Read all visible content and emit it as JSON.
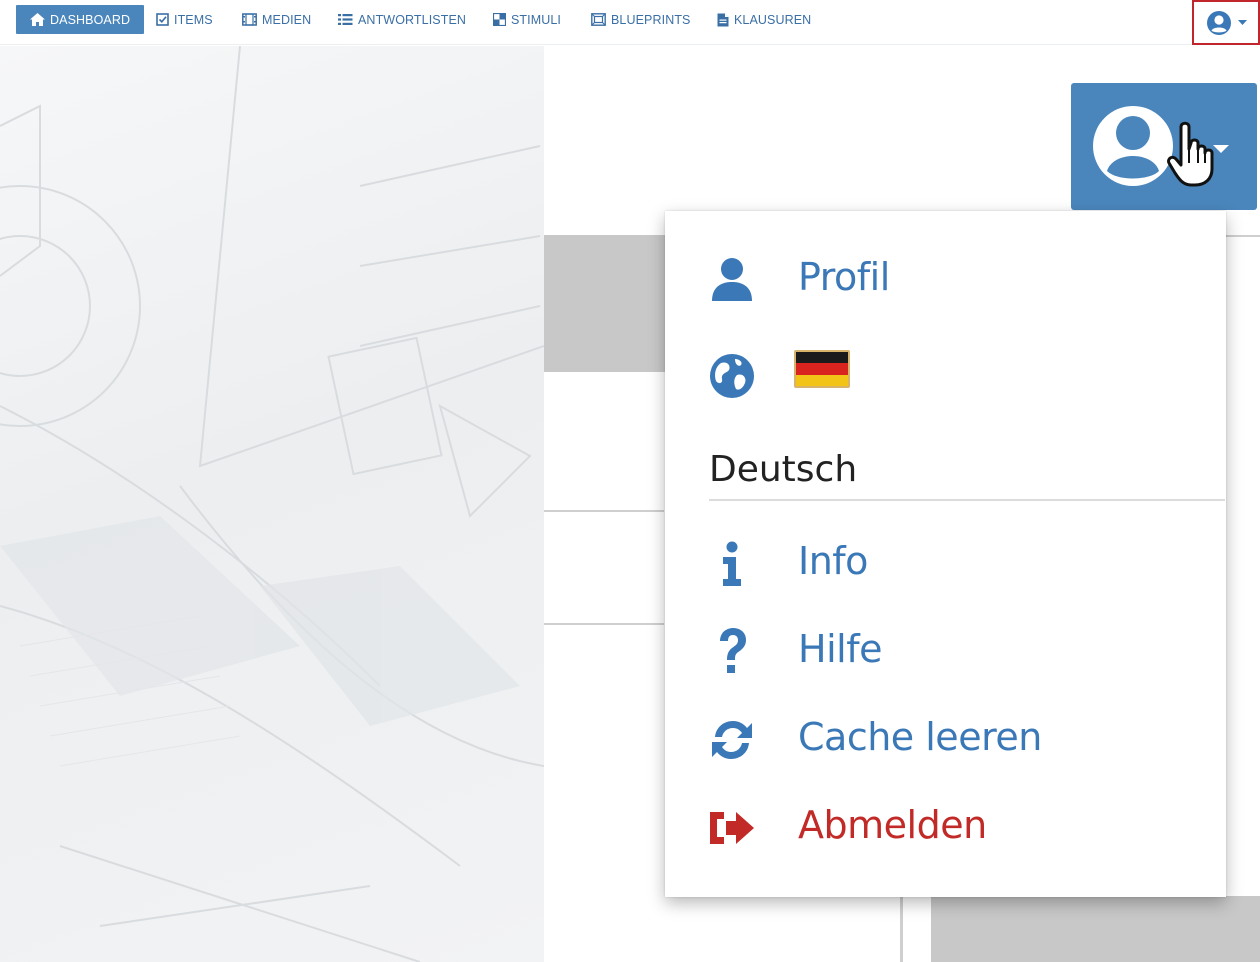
{
  "navbar": {
    "items": [
      {
        "label": "DASHBOARD",
        "icon": "home-icon",
        "active": true
      },
      {
        "label": "ITEMS",
        "icon": "checkbox-icon"
      },
      {
        "label": "MEDIEN",
        "icon": "film-icon"
      },
      {
        "label": "ANTWORTLISTEN",
        "icon": "list-icon"
      },
      {
        "label": "STIMULI",
        "icon": "stimuli-icon"
      },
      {
        "label": "BLUEPRINTS",
        "icon": "blueprint-icon"
      },
      {
        "label": "KLAUSUREN",
        "icon": "document-icon"
      }
    ],
    "user_icon": "user-circle-icon"
  },
  "dropdown": {
    "profile_label": "Profil",
    "language_icon": "globe-icon",
    "language_flag": "german-flag",
    "language_label": "Deutsch",
    "info_label": "Info",
    "help_label": "Hilfe",
    "cache_label": "Cache leeren",
    "logout_label": "Abmelden"
  },
  "colors": {
    "accent": "#4a86bc",
    "link": "#3a78b7",
    "danger": "#c12a27",
    "highlight_border": "#c0262b"
  }
}
